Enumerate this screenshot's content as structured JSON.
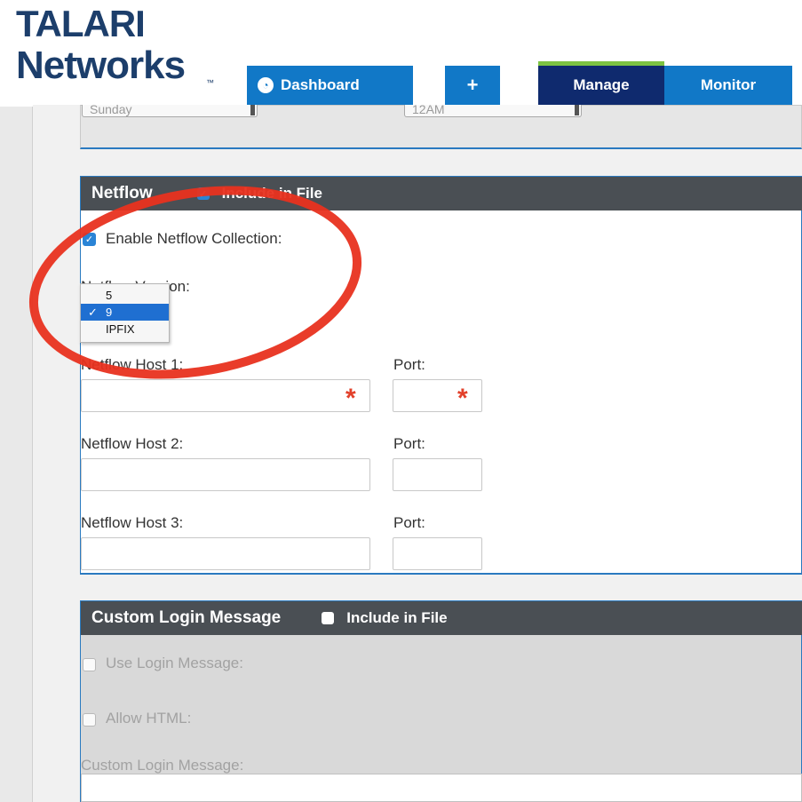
{
  "brand": {
    "line1": "TALARI",
    "line2": "Networks",
    "tm": "™"
  },
  "nav": {
    "dashboard": "Dashboard",
    "add": "+",
    "manage": "Manage",
    "monitor": "Monitor"
  },
  "top_panel": {
    "day_value": "Sunday",
    "time_value": "12AM"
  },
  "netflow": {
    "title": "Netflow",
    "include_label": "Include in File",
    "include_checked": true,
    "enable_label": "Enable Netflow Collection:",
    "enable_checked": true,
    "version_label": "Netflow Version:",
    "version_options": [
      "5",
      "9",
      "IPFIX"
    ],
    "version_selected": "9",
    "hosts": [
      {
        "host_label": "Netflow Host 1:",
        "port_label": "Port:",
        "required": true
      },
      {
        "host_label": "Netflow Host 2:",
        "port_label": "Port:",
        "required": false
      },
      {
        "host_label": "Netflow Host 3:",
        "port_label": "Port:",
        "required": false
      }
    ],
    "required_mark": "*"
  },
  "login": {
    "title": "Custom Login Message",
    "include_label": "Include in File",
    "include_checked": false,
    "use_label": "Use Login Message:",
    "allow_html_label": "Allow HTML:",
    "message_label": "Custom Login Message:"
  },
  "colors": {
    "brand": "#1c3e6b",
    "tab_blue": "#1178c7",
    "tab_active": "#0f2a6e",
    "tab_accent": "#7cc341",
    "header_gray": "#4a4f54",
    "required_red": "#e2402a",
    "annotation_red": "#e8321f"
  },
  "icons": {
    "dashboard": "dashboard-icon",
    "checkmark": "check-icon",
    "required": "required-asterisk-icon"
  }
}
